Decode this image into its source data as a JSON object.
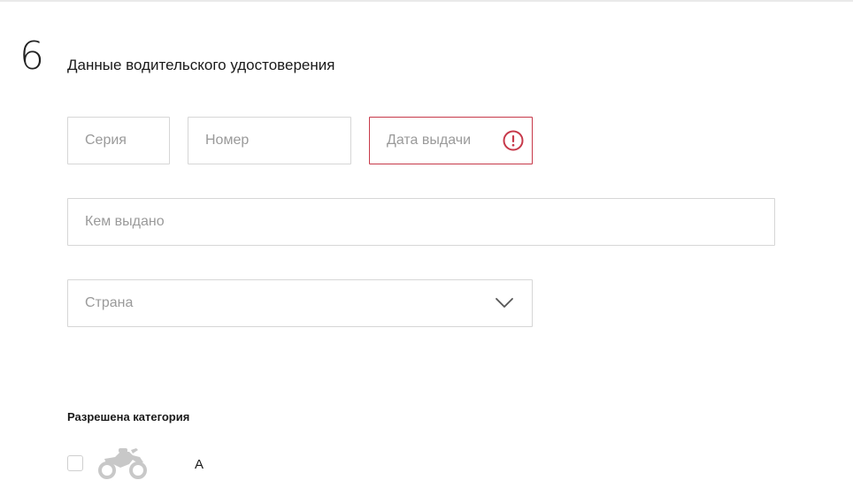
{
  "section": {
    "number": "6",
    "title": "Данные водительского удостоверения"
  },
  "fields": {
    "series": {
      "placeholder": "Серия",
      "value": ""
    },
    "number": {
      "placeholder": "Номер",
      "value": ""
    },
    "issue_date": {
      "placeholder": "Дата выдачи",
      "value": "",
      "state": "error"
    },
    "issued_by": {
      "placeholder": "Кем выдано",
      "value": ""
    },
    "country": {
      "placeholder": "Страна",
      "selected": ""
    }
  },
  "categories": {
    "heading": "Разрешена категория",
    "items": [
      {
        "label": "A",
        "icon": "motorcycle-icon",
        "checked": false
      }
    ]
  },
  "colors": {
    "error": "#c7394a",
    "border": "#d6d6d6",
    "placeholder": "#9a9a9a",
    "icon_gray": "#c8c8c8"
  }
}
